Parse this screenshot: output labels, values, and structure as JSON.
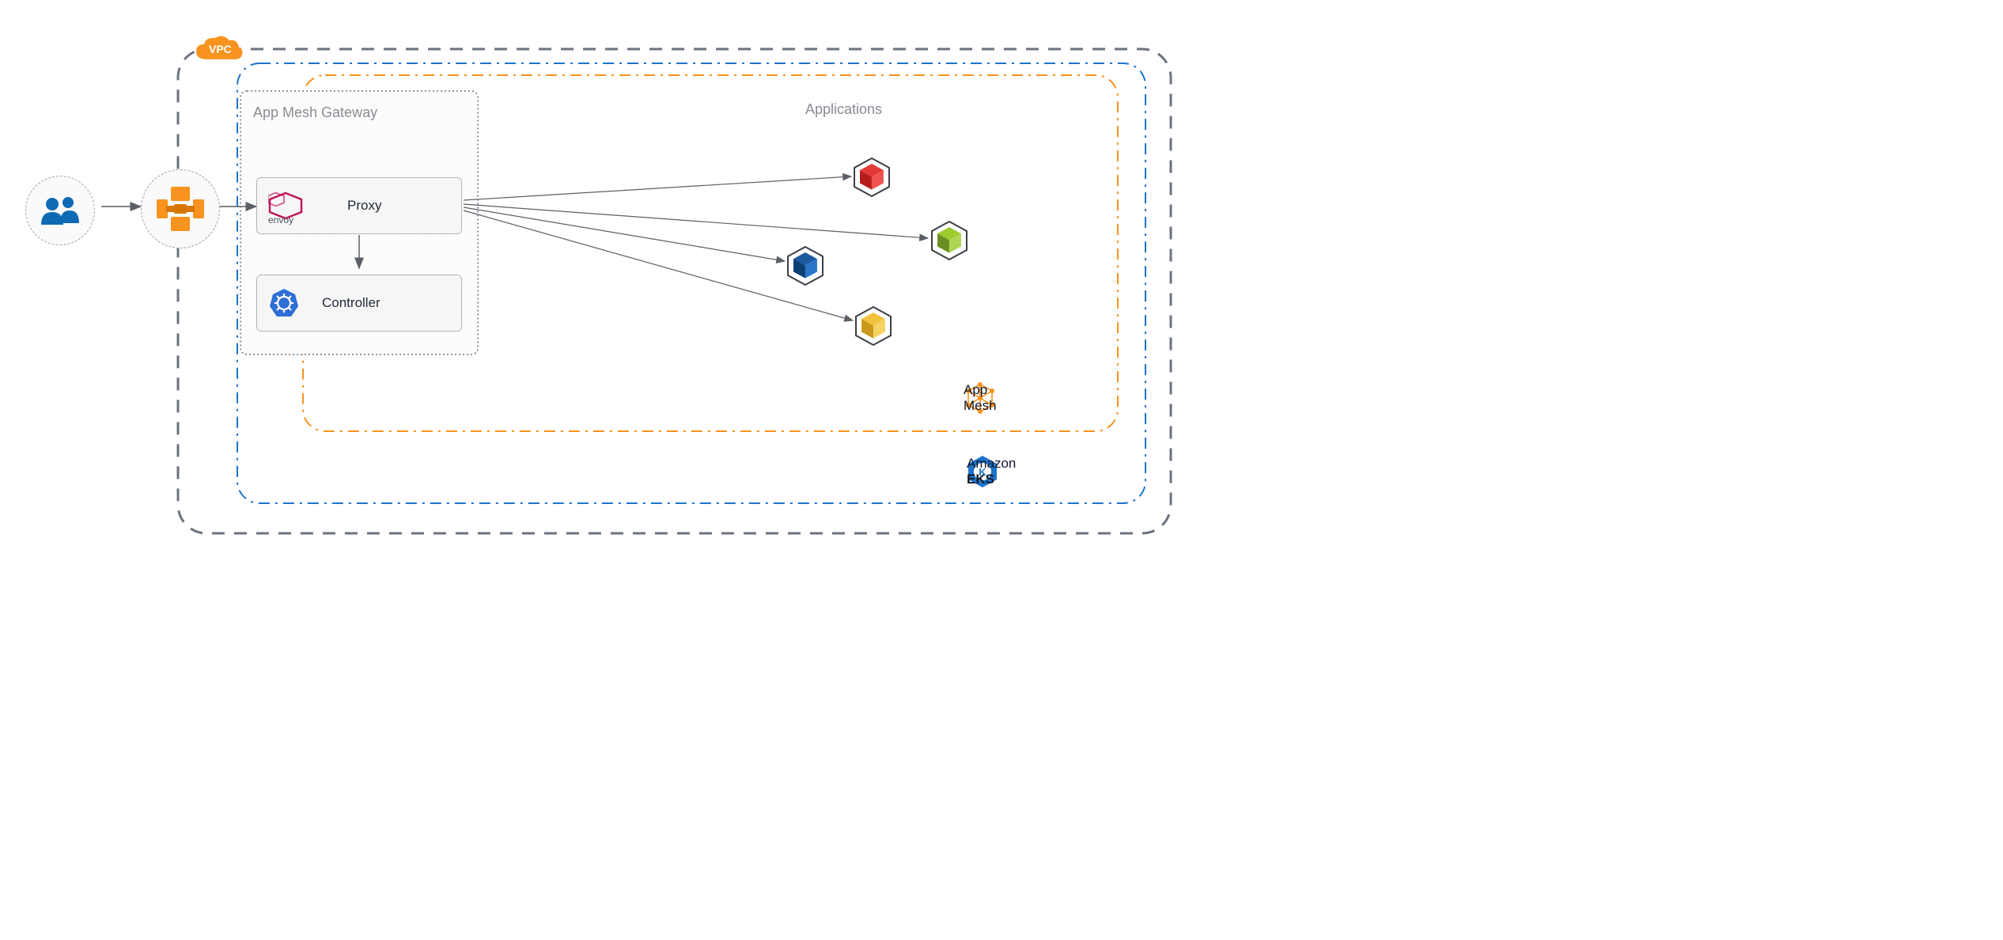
{
  "vpc_badge": "VPC",
  "gateway_title": "App Mesh Gateway",
  "proxy_label": "Proxy",
  "controller_label": "Controller",
  "applications_title": "Applications",
  "appmesh_label": "App Mesh",
  "eks_label_prefix": "Amazon",
  "eks_label_suffix": "EKS"
}
